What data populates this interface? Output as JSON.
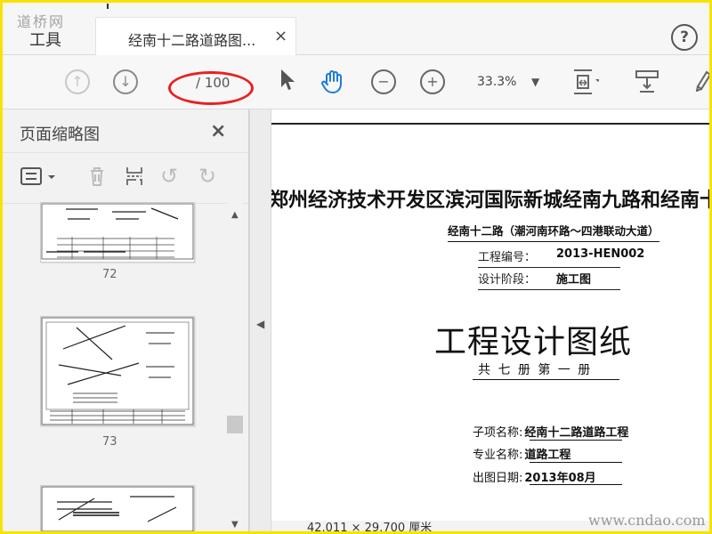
{
  "watermark_top": "道桥网",
  "watermark_bottom": "www.cndao.com",
  "tabs": {
    "tools": "工具",
    "doc_tab_title": "经南十二路道路图...",
    "close": "×"
  },
  "toolbar": {
    "page_input": "",
    "page_total": "/ 100",
    "zoom": "33.3%"
  },
  "sidebar": {
    "title": "页面缩略图",
    "close": "×",
    "pages": [
      "72",
      "73"
    ]
  },
  "document": {
    "project_title": "郑州经济技术开发区滨河国际新城经南九路和经南十二路",
    "road_subtitle": "经南十二路（潮河南环路～四港联动大道）",
    "project_code_label": "工程编号：",
    "project_code_value": "2013-HEN002",
    "design_stage_label": "设计阶段：",
    "design_stage_value": "施工图",
    "main_title": "工程设计图纸",
    "volume_info": "共 七 册   第 一 册",
    "subproject_label": "子项名称:",
    "subproject_value": "经南十二路道路工程",
    "major_label": "专业名称:",
    "major_value": "道路工程",
    "date_label": "出图日期:",
    "date_value": "2013年08月",
    "status_text": "42.011 × 29.700 厘米"
  }
}
